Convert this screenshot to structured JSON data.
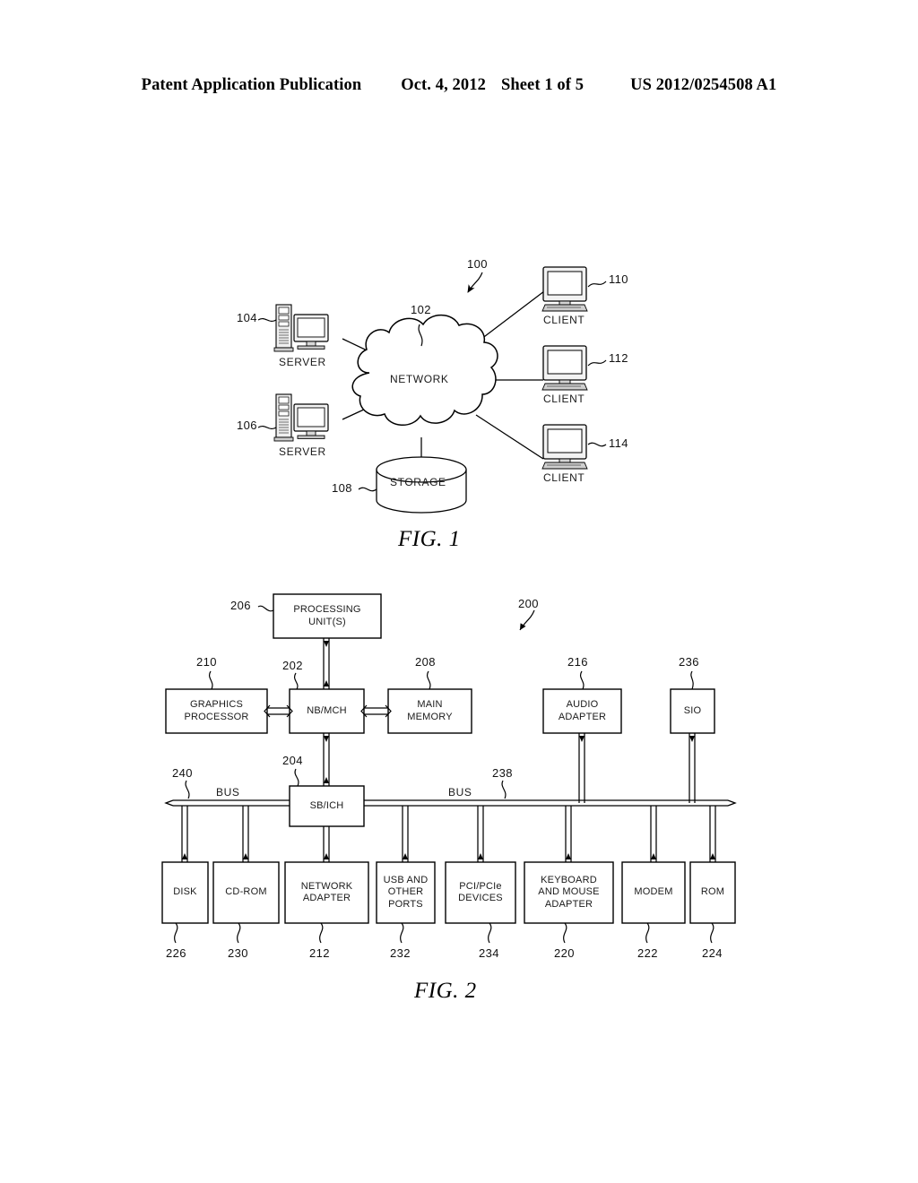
{
  "header": {
    "title": "Patent Application Publication",
    "date": "Oct. 4, 2012",
    "sheet": "Sheet 1 of 5",
    "number": "US 2012/0254508 A1"
  },
  "figures": [
    {
      "caption": "FIG. 1"
    },
    {
      "caption": "FIG. 2"
    }
  ],
  "fig1": {
    "caption": "FIG. 1",
    "system_ref": "100",
    "nodes": [
      {
        "id": "server1",
        "label": "SERVER",
        "ref": "104"
      },
      {
        "id": "server2",
        "label": "SERVER",
        "ref": "106"
      },
      {
        "id": "network",
        "label": "NETWORK",
        "ref": "102"
      },
      {
        "id": "storage",
        "label": "STORAGE",
        "ref": "108"
      },
      {
        "id": "client1",
        "label": "CLIENT",
        "ref": "110"
      },
      {
        "id": "client2",
        "label": "CLIENT",
        "ref": "112"
      },
      {
        "id": "client3",
        "label": "CLIENT",
        "ref": "114"
      }
    ]
  },
  "fig2": {
    "caption": "FIG. 2",
    "system_ref": "200",
    "bus_left_label": "BUS",
    "bus_left_ref": "240",
    "bus_right_label": "BUS",
    "bus_right_ref": "238",
    "blocks": [
      {
        "id": "processing-unit",
        "label": "PROCESSING\nUNIT(S)",
        "lines": [
          "PROCESSING",
          "UNIT(S)"
        ],
        "ref": "206"
      },
      {
        "id": "graphics-processor",
        "label": "GRAPHICS\nPROCESSOR",
        "lines": [
          "GRAPHICS",
          "PROCESSOR"
        ],
        "ref": "210"
      },
      {
        "id": "nb-mch",
        "label": "NB/MCH",
        "lines": [
          "NB/MCH"
        ],
        "ref": "202"
      },
      {
        "id": "main-memory",
        "label": "MAIN\nMEMORY",
        "lines": [
          "MAIN",
          "MEMORY"
        ],
        "ref": "208"
      },
      {
        "id": "audio-adapter",
        "label": "AUDIO\nADAPTER",
        "lines": [
          "AUDIO",
          "ADAPTER"
        ],
        "ref": "216"
      },
      {
        "id": "sio",
        "label": "SIO",
        "lines": [
          "SIO"
        ],
        "ref": "236"
      },
      {
        "id": "sb-ich",
        "label": "SB/ICH",
        "lines": [
          "SB/ICH"
        ],
        "ref": "204"
      },
      {
        "id": "disk",
        "label": "DISK",
        "lines": [
          "DISK"
        ],
        "ref": "226"
      },
      {
        "id": "cd-rom",
        "label": "CD-ROM",
        "lines": [
          "CD-ROM"
        ],
        "ref": "230"
      },
      {
        "id": "network-adapter",
        "label": "NETWORK\nADAPTER",
        "lines": [
          "NETWORK",
          "ADAPTER"
        ],
        "ref": "212"
      },
      {
        "id": "usb-ports",
        "label": "USB AND\nOTHER\nPORTS",
        "lines": [
          "USB AND",
          "OTHER",
          "PORTS"
        ],
        "ref": "232"
      },
      {
        "id": "pci-devices",
        "label": "PCI/PCIe\nDEVICES",
        "lines": [
          "PCI/PCIe",
          "DEVICES"
        ],
        "ref": "234"
      },
      {
        "id": "keyboard-mouse",
        "label": "KEYBOARD\nAND MOUSE\nADAPTER",
        "lines": [
          "KEYBOARD",
          "AND MOUSE",
          "ADAPTER"
        ],
        "ref": "220"
      },
      {
        "id": "modem",
        "label": "MODEM",
        "lines": [
          "MODEM"
        ],
        "ref": "222"
      },
      {
        "id": "rom",
        "label": "ROM",
        "lines": [
          "ROM"
        ],
        "ref": "224"
      }
    ]
  },
  "colors": {
    "ink": "#000000",
    "paper": "#ffffff",
    "label_ink": "#1a1a1a"
  }
}
